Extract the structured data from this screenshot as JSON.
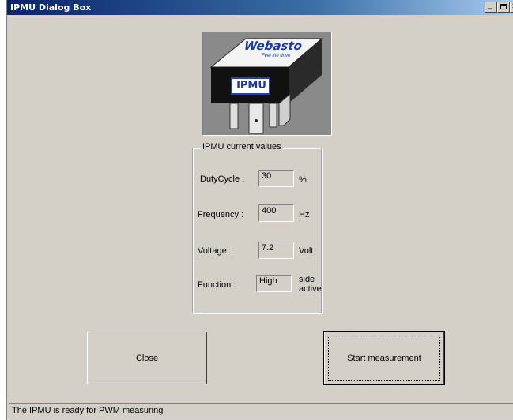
{
  "window": {
    "title": "IPMU Dialog Box",
    "minimize_glyph": "_",
    "maximize_glyph": "□",
    "close_glyph": "✕"
  },
  "logo": {
    "brand": "Webasto",
    "tagline": "Feel the drive",
    "device_label": "IPMU"
  },
  "group": {
    "title": "IPMU current values",
    "rows": [
      {
        "label": "DutyCycle :",
        "value": "30",
        "unit": "%"
      },
      {
        "label": "Frequency :",
        "value": "400",
        "unit": "Hz"
      },
      {
        "label": "Voltage:",
        "value": "7.2",
        "unit": "Volt"
      },
      {
        "label": "Function :",
        "value": "High",
        "unit": "side active"
      }
    ]
  },
  "buttons": {
    "close_label": "Close",
    "start_label": "Start measurement"
  },
  "status": {
    "text": "The IPMU is ready for PWM measuring"
  },
  "colors": {
    "face": "#d4d0c8",
    "titlebar": "#0a246a",
    "brand_blue": "#1a3aa8"
  }
}
